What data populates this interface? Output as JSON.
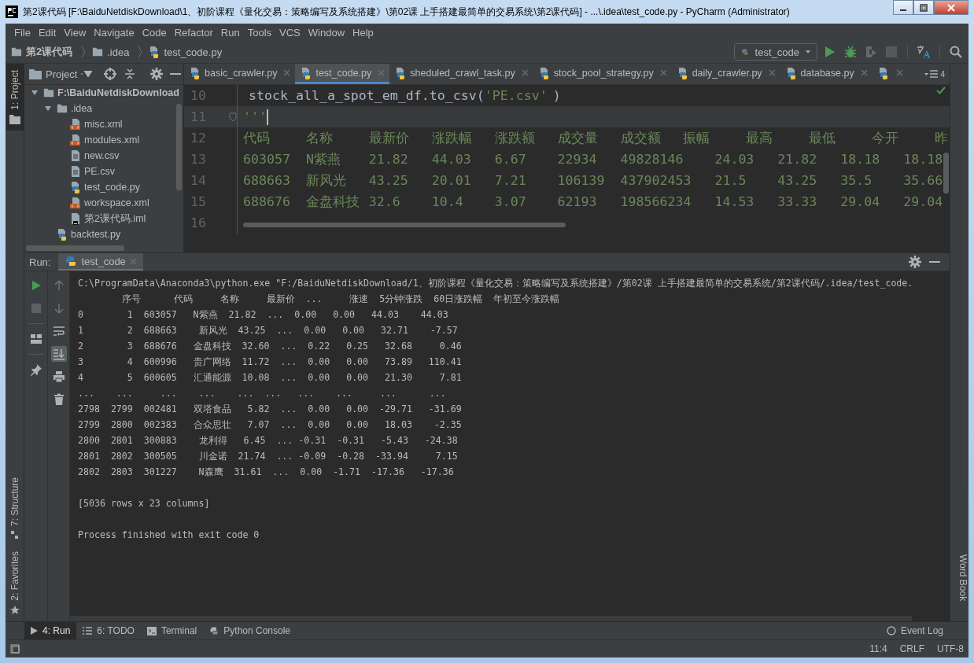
{
  "window": {
    "title": "第2课代码 [F:\\BaiduNetdiskDownload\\1、初阶课程《量化交易：策略编写及系统搭建》\\第02课 上手搭建最简单的交易系统\\第2课代码] - ...\\.idea\\test_code.py - PyCharm (Administrator)"
  },
  "menu": [
    "File",
    "Edit",
    "View",
    "Navigate",
    "Code",
    "Refactor",
    "Run",
    "Tools",
    "VCS",
    "Window",
    "Help"
  ],
  "breadcrumbs": [
    {
      "label": "第2课代码",
      "kind": "folder"
    },
    {
      "label": ".idea",
      "kind": "folder"
    },
    {
      "label": "test_code.py",
      "kind": "python"
    }
  ],
  "run_config": {
    "label": "test_code"
  },
  "toolbar": [
    {
      "kind": "run",
      "disabled": false
    },
    {
      "kind": "debug",
      "disabled": false
    },
    {
      "kind": "coverage",
      "disabled": true
    },
    {
      "kind": "stop",
      "disabled": true
    },
    {
      "kind": "translate",
      "disabled": false
    },
    {
      "kind": "search",
      "disabled": false
    }
  ],
  "left_tool_tabs_top": [
    {
      "label": "1: Project",
      "selected": true
    }
  ],
  "left_tool_tabs_bottom": [
    {
      "label": "7: Structure",
      "selected": false
    },
    {
      "label": "2: Favorites",
      "selected": false
    }
  ],
  "right_tool_tabs": [
    {
      "label": "Word Book",
      "selected": false
    }
  ],
  "project_panel": {
    "title": "Project",
    "tree": [
      {
        "label": "F:\\BaiduNetdiskDownload",
        "kind": "folder",
        "expanded": true,
        "children": [
          {
            "label": ".idea",
            "kind": "folder",
            "expanded": true,
            "children": [
              {
                "label": "misc.xml",
                "kind": "xml"
              },
              {
                "label": "modules.xml",
                "kind": "xml"
              },
              {
                "label": "new.csv",
                "kind": "csv"
              },
              {
                "label": "PE.csv",
                "kind": "csv"
              },
              {
                "label": "test_code.py",
                "kind": "python"
              },
              {
                "label": "workspace.xml",
                "kind": "xml"
              },
              {
                "label": "第2课代码.iml",
                "kind": "iml"
              }
            ]
          },
          {
            "label": "backtest.py",
            "kind": "python"
          }
        ]
      }
    ]
  },
  "editor": {
    "tabs": [
      {
        "label": "basic_crawler.py",
        "selected": false
      },
      {
        "label": "test_code.py",
        "selected": true
      },
      {
        "label": "sheduled_crawl_task.py",
        "selected": false
      },
      {
        "label": "stock_pool_strategy.py",
        "selected": false
      },
      {
        "label": "daily_crawler.py",
        "selected": false
      },
      {
        "label": "database.py",
        "selected": false
      },
      {
        "selected": false
      }
    ],
    "overflow_count": "4",
    "lines": [
      {
        "number": "10",
        "current": false,
        "segments": [
          {
            "kind": "code",
            "text": "stock_all_a_spot_em_df.to_csv("
          },
          {
            "kind": "string",
            "text": "'PE.csv'"
          },
          {
            "kind": "code",
            "text": ")"
          }
        ]
      },
      {
        "number": "11",
        "current": true,
        "fold": true,
        "caret": true,
        "segments": [
          {
            "kind": "string",
            "text": "'''"
          }
        ]
      },
      {
        "number": "12",
        "current": false,
        "cells": [
          "代码",
          "名称",
          "最新价",
          "涨跌幅",
          "涨跌额",
          "成交量",
          "成交额",
          "振幅",
          "最高",
          "最低",
          "今开",
          "昨"
        ]
      },
      {
        "number": "13",
        "current": false,
        "cells": [
          "603057",
          "N紫燕",
          "21.82",
          "44.03",
          "6.67",
          "22934",
          "49828146",
          "24.03",
          "21.82",
          "18.18",
          "18.18"
        ]
      },
      {
        "number": "14",
        "current": false,
        "cells": [
          "688663",
          "新风光",
          "43.25",
          "20.01",
          "7.21",
          "106139",
          "437902453",
          "21.5",
          "43.25",
          "35.5",
          "35.66"
        ]
      },
      {
        "number": "15",
        "current": false,
        "cells": [
          "688676",
          "金盘科技",
          "32.6",
          "10.4",
          "3.07",
          "62193",
          "198566234",
          "14.53",
          "33.33",
          "29.04",
          "29.04"
        ]
      },
      {
        "number": "16",
        "current": false
      }
    ]
  },
  "run_panel": {
    "label": "Run:",
    "tab": {
      "label": "test_code",
      "selected": true
    },
    "tools_main": [
      {
        "kind": "rerun",
        "disabled": false
      },
      {
        "kind": "stop",
        "disabled": true
      },
      {
        "kind": "layout",
        "disabled": false
      },
      {
        "kind": "pin",
        "disabled": false
      }
    ],
    "tools_side": [
      {
        "kind": "up",
        "disabled": true,
        "on": false
      },
      {
        "kind": "down",
        "disabled": true,
        "on": false
      },
      {
        "kind": "wrap",
        "disabled": false,
        "on": false
      },
      {
        "kind": "scroll-end",
        "disabled": false,
        "on": true
      },
      {
        "kind": "print",
        "disabled": false,
        "on": false
      },
      {
        "kind": "trash",
        "disabled": false,
        "on": false
      }
    ]
  },
  "console": {
    "command": "C:\\ProgramData\\Anaconda3\\python.exe \"F:/BaiduNetdiskDownload/1、初阶课程《量化交易：策略编写及系统搭建》/第02课 上手搭建最简单的交易系统/第2课代码/.idea/test_code.",
    "header": "        序号      代码     名称     最新价  ...     涨速  5分钟涨跌  60日涨跌幅  年初至今涨跌幅",
    "rows": [
      "0        1  603057   N紫燕  21.82  ...  0.00   0.00   44.03    44.03",
      "1        2  688663    新风光  43.25  ...  0.00   0.00   32.71    -7.57",
      "2        3  688676   金盘科技  32.60  ...  0.22   0.25   32.68     0.46",
      "3        4  600996   贵广网络  11.72  ...  0.00   0.00   73.89   110.41",
      "4        5  600605   汇通能源  10.08  ...  0.00   0.00   21.30     7.81",
      "...    ...     ...    ...    ...  ...   ...    ...     ...      ...",
      "2798  2799  002481   双塔食品   5.82  ...  0.00   0.00  -29.71   -31.69",
      "2799  2800  002383   合众思壮   7.07  ...  0.00   0.00   18.03    -2.35",
      "2800  2801  300883    龙利得   6.45  ... -0.31  -0.31   -5.43   -24.38",
      "2801  2802  300505    川金诺  21.74  ... -0.09  -0.28  -33.94     7.15",
      "2802  2803  301227    N森鹰  31.61  ...  0.00  -1.71  -17.36   -17.36"
    ],
    "summary": "[5036 rows x 23 columns]",
    "exit_message": "Process finished with exit code 0"
  },
  "bottom_tool_tabs": [
    {
      "label": "4: Run",
      "kind": "run",
      "selected": true
    },
    {
      "label": "6: TODO",
      "kind": "todo",
      "selected": false
    },
    {
      "label": "Terminal",
      "kind": "terminal",
      "selected": false
    },
    {
      "label": "Python Console",
      "kind": "python",
      "selected": false
    }
  ],
  "event_log": {
    "label": "Event Log"
  },
  "status_bar": {
    "items": [
      "11:4",
      "CRLF",
      "UTF-8"
    ]
  }
}
